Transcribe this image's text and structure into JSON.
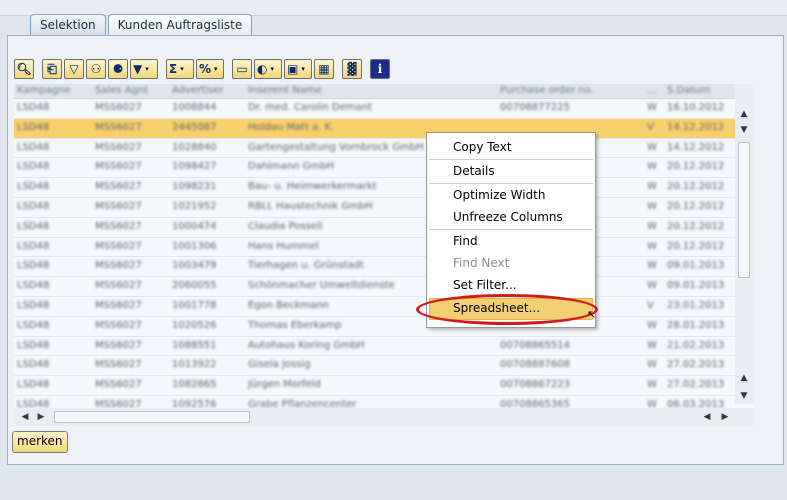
{
  "tabs": [
    {
      "label": "Selektion"
    },
    {
      "label": "Kunden Auftragsliste"
    }
  ],
  "toolbar": {
    "icons": [
      "details-icon",
      "print-icon",
      "filter-icon",
      "find-icon",
      "find-next-icon",
      "set-filter-icon",
      "sum-icon",
      "subtotal-icon",
      "print-preview-icon",
      "views-icon",
      "export-icon",
      "layout-icon",
      "graphic-icon",
      "info-icon"
    ]
  },
  "grid": {
    "headers": [
      "Kampagne",
      "Sales Agnt",
      "Advertiser",
      "Inserent Name",
      "Purchase order no.",
      "...",
      "S.Datum"
    ],
    "rows": [
      [
        "LSD48",
        "MSS6027",
        "1008844",
        "Dr. med. Carolin Demant",
        "00708877225",
        "W",
        "16.10.2012"
      ],
      [
        "LSD48",
        "MSS6027",
        "2445087",
        "Holdau Matt a. K.",
        "",
        "V",
        "14.12.2012"
      ],
      [
        "LSD48",
        "MSS6027",
        "1028840",
        "Gartengestaltung Vornbrock GmbH",
        "",
        "W",
        "14.12.2012"
      ],
      [
        "LSD48",
        "MSS6027",
        "1098427",
        "Dahlmann GmbH",
        "",
        "W",
        "20.12.2012"
      ],
      [
        "LSD48",
        "MSS6027",
        "1098231",
        "Bau- u. Heimwerkermarkt",
        "",
        "W",
        "20.12.2012"
      ],
      [
        "LSD48",
        "MSS6027",
        "1021952",
        "RBLL Haustechnik GmbH",
        "",
        "W",
        "20.12.2012"
      ],
      [
        "LSD48",
        "MSS6027",
        "1000474",
        "Claudia Possell",
        "",
        "W",
        "20.12.2012"
      ],
      [
        "LSD48",
        "MSS6027",
        "1001306",
        "Hans Hummel",
        "",
        "W",
        "20.12.2012"
      ],
      [
        "LSD48",
        "MSS6027",
        "1003479",
        "Tierhagen u. Grünstadt",
        "",
        "W",
        "09.01.2013"
      ],
      [
        "LSD48",
        "MSS6027",
        "2060055",
        "Schönmacher Umweltdienste",
        "",
        "W",
        "09.01.2013"
      ],
      [
        "LSD48",
        "MSS6027",
        "1001778",
        "Egon Beckmann",
        "",
        "V",
        "23.01.2013"
      ],
      [
        "LSD48",
        "MSS6027",
        "1020526",
        "Thomas Eberkamp",
        "",
        "W",
        "28.01.2013"
      ],
      [
        "LSD48",
        "MSS6027",
        "1088551",
        "Autohaus Koring GmbH",
        "00708865514",
        "W",
        "21.02.2013"
      ],
      [
        "LSD48",
        "MSS6027",
        "1013922",
        "Gisela Jossig",
        "00708887608",
        "W",
        "27.02.2013"
      ],
      [
        "LSD48",
        "MSS6027",
        "1082865",
        "Jürgen Morfeld",
        "00708867223",
        "W",
        "27.02.2013"
      ],
      [
        "LSD48",
        "MSS6027",
        "1092576",
        "Grabe Pflanzencenter",
        "00708865365",
        "W",
        "06.03.2013"
      ]
    ],
    "selected_row": 1
  },
  "context_menu": {
    "copy_text": "Copy Text",
    "details": "Details",
    "optimize_width": "Optimize Width",
    "unfreeze_columns": "Unfreeze Columns",
    "find": "Find",
    "find_next": "Find Next",
    "set_filter": "Set Filter...",
    "spreadsheet": "Spreadsheet..."
  },
  "footer": {
    "merken": "merken"
  },
  "colors": {
    "highlight": "#f8d06b",
    "annotation": "#d11a1a",
    "accent": "#f3d77a"
  }
}
